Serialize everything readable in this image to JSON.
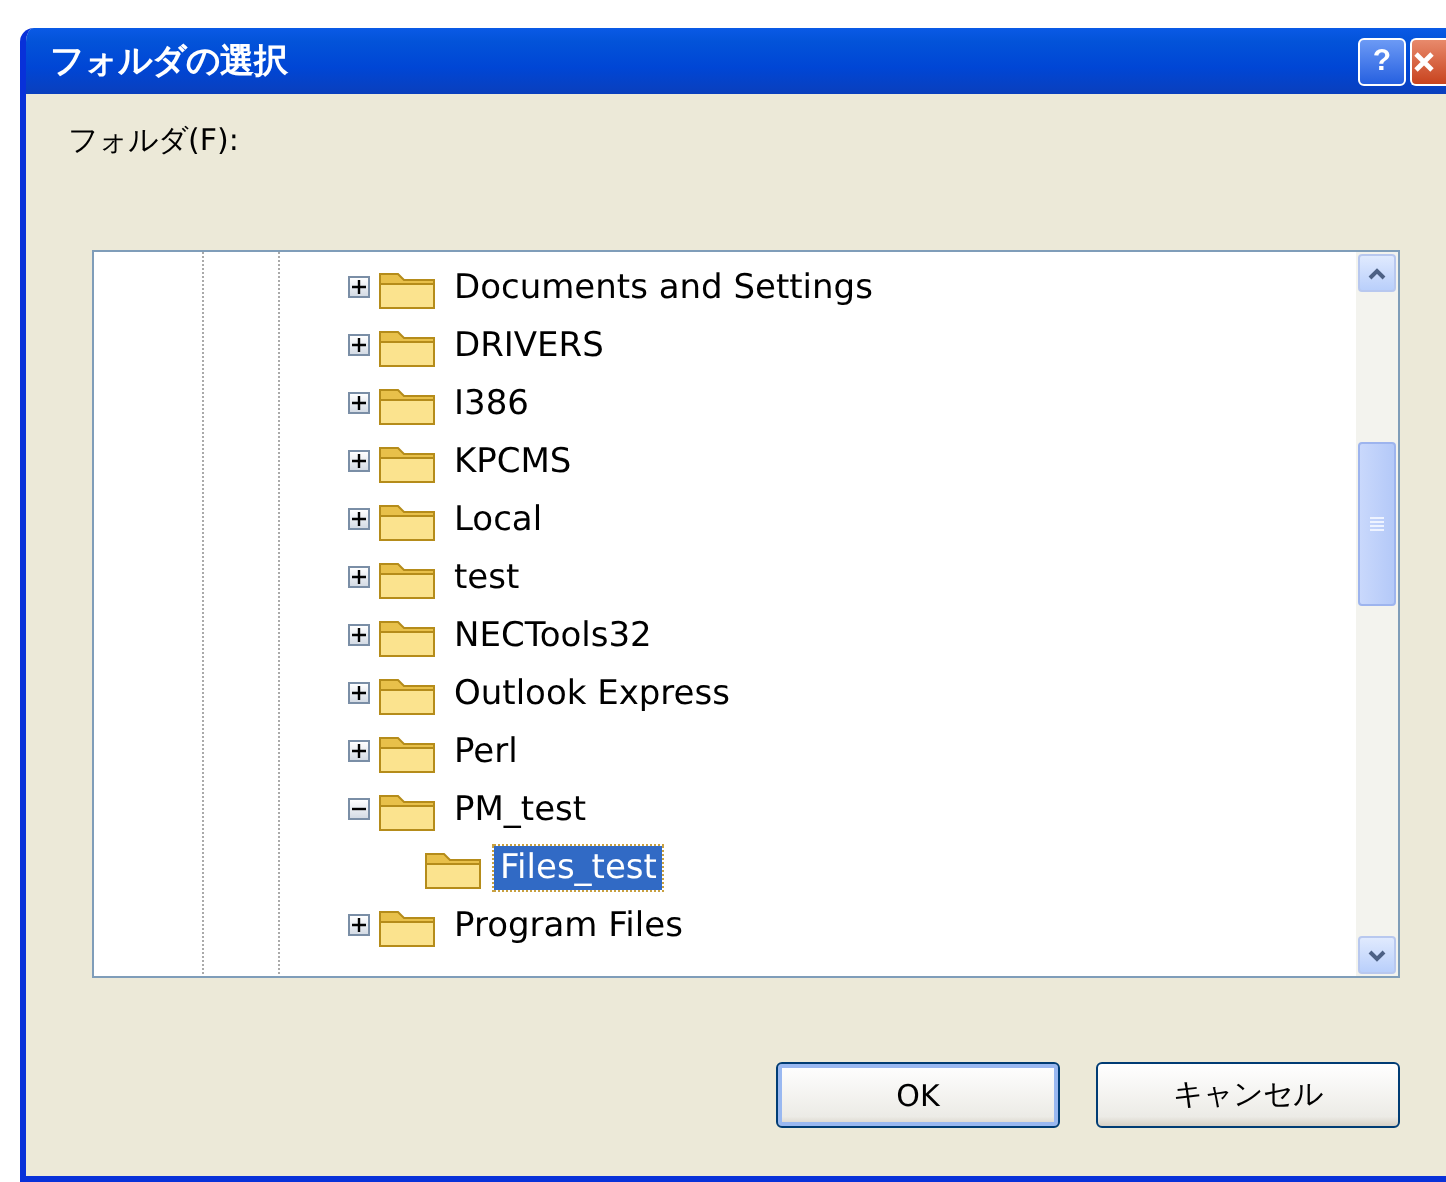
{
  "window": {
    "title": "フォルダの選択",
    "help_button": "?"
  },
  "tree_label": "フォルダ(F):",
  "tree": [
    {
      "name": "Documents and Settings",
      "expanded": false,
      "selected": false
    },
    {
      "name": "DRIVERS",
      "expanded": false,
      "selected": false
    },
    {
      "name": "I386",
      "expanded": false,
      "selected": false
    },
    {
      "name": "KPCMS",
      "expanded": false,
      "selected": false
    },
    {
      "name": "Local",
      "expanded": false,
      "selected": false
    },
    {
      "name": "test",
      "expanded": false,
      "selected": false
    },
    {
      "name": "NECTools32",
      "expanded": false,
      "selected": false
    },
    {
      "name": "Outlook Express",
      "expanded": false,
      "selected": false
    },
    {
      "name": "Perl",
      "expanded": false,
      "selected": false
    },
    {
      "name": "PM_test",
      "expanded": true,
      "selected": false,
      "children": [
        {
          "name": "Files_test",
          "selected": true
        }
      ]
    },
    {
      "name": "Program Files",
      "expanded": false,
      "selected": false
    }
  ],
  "buttons": [
    {
      "label": "OK",
      "default": true
    },
    {
      "label": "キャンセル",
      "default": false
    }
  ]
}
